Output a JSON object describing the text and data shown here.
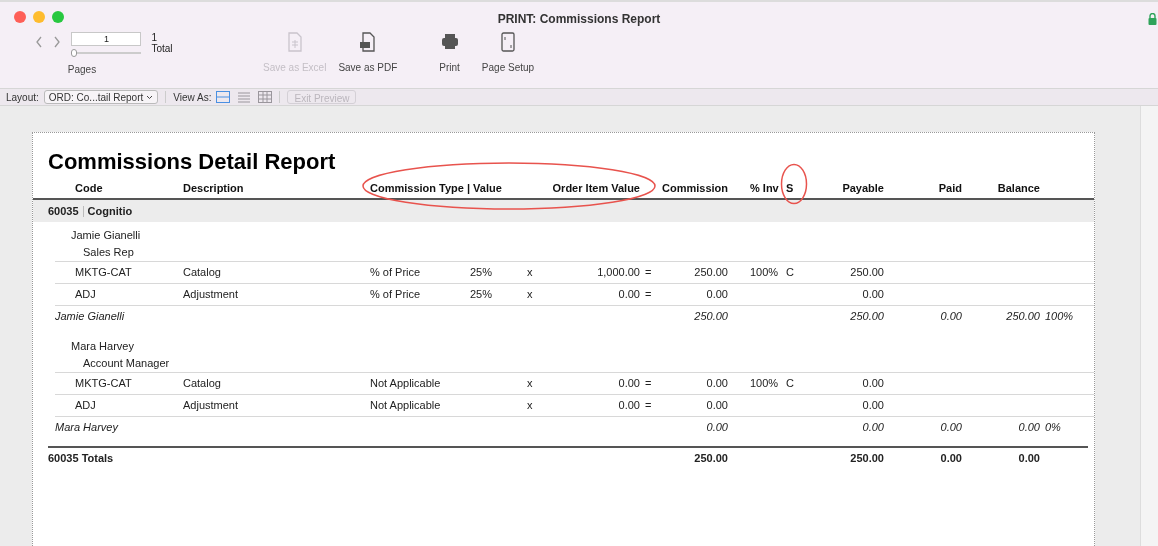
{
  "window": {
    "title": "PRINT: Commissions Report"
  },
  "toolbar": {
    "pager": {
      "page_value": "1",
      "total_count": "1",
      "total_label": "Total",
      "label": "Pages",
      "slider": {
        "level": 0
      }
    },
    "actions": [
      {
        "label": "Save as Excel",
        "kind": "excel",
        "disabled": true
      },
      {
        "label": "Save as PDF",
        "kind": "pdf",
        "disabled": false
      },
      {
        "label": "Print",
        "kind": "print",
        "disabled": false
      },
      {
        "label": "Page Setup",
        "kind": "setup",
        "disabled": false
      }
    ]
  },
  "layout_bar": {
    "layout_label": "Layout:",
    "layout_value": "ORD: Co...tail Report",
    "view_as_label": "View As:",
    "view_modes": [
      {
        "kind": "form",
        "selected": true
      },
      {
        "kind": "list",
        "selected": false
      },
      {
        "kind": "table",
        "selected": false
      }
    ],
    "exit_preview": {
      "label": "Exit Preview",
      "disabled": true
    }
  },
  "report": {
    "title": "Commissions Detail Report",
    "columns": [
      "Code",
      "Description",
      "Commission Type | Value",
      "Order Item Value",
      "Commission",
      "% Inv",
      "S",
      "Payable",
      "Paid",
      "Balance"
    ],
    "group": {
      "code": "60035",
      "name": "Cognitio"
    },
    "reps": [
      {
        "name": "Jamie Gianelli",
        "role": "Sales Rep",
        "items": [
          {
            "code": "MKTG-CAT",
            "description": "Catalog",
            "type": "% of Price",
            "value": "25%",
            "times": "x",
            "order_item_value": "1,000.00",
            "equals": "=",
            "commission": "250.00",
            "pct_inv": "100%",
            "s": "C",
            "payable": "250.00"
          },
          {
            "code": "ADJ",
            "description": "Adjustment",
            "type": "% of Price",
            "value": "25%",
            "times": "x",
            "order_item_value": "0.00",
            "equals": "=",
            "commission": "0.00",
            "payable": "0.00"
          }
        ],
        "subtotal": {
          "name": "Jamie Gianelli",
          "commission": "250.00",
          "payable": "250.00",
          "paid": "0.00",
          "balance": "250.00",
          "pct": "100%"
        }
      },
      {
        "name": "Mara Harvey",
        "role": "Account Manager",
        "items": [
          {
            "code": "MKTG-CAT",
            "description": "Catalog",
            "type": "Not Applicable",
            "times": "x",
            "order_item_value": "0.00",
            "equals": "=",
            "commission": "0.00",
            "pct_inv": "100%",
            "s": "C",
            "payable": "0.00"
          },
          {
            "code": "ADJ",
            "description": "Adjustment",
            "type": "Not Applicable",
            "times": "x",
            "order_item_value": "0.00",
            "equals": "=",
            "commission": "0.00",
            "payable": "0.00"
          }
        ],
        "subtotal": {
          "name": "Mara Harvey",
          "commission": "0.00",
          "payable": "0.00",
          "paid": "0.00",
          "balance": "0.00",
          "pct": "0%"
        }
      }
    ],
    "totals": {
      "label": "60035 Totals",
      "commission": "250.00",
      "payable": "250.00",
      "paid": "0.00",
      "balance": "0.00"
    }
  }
}
